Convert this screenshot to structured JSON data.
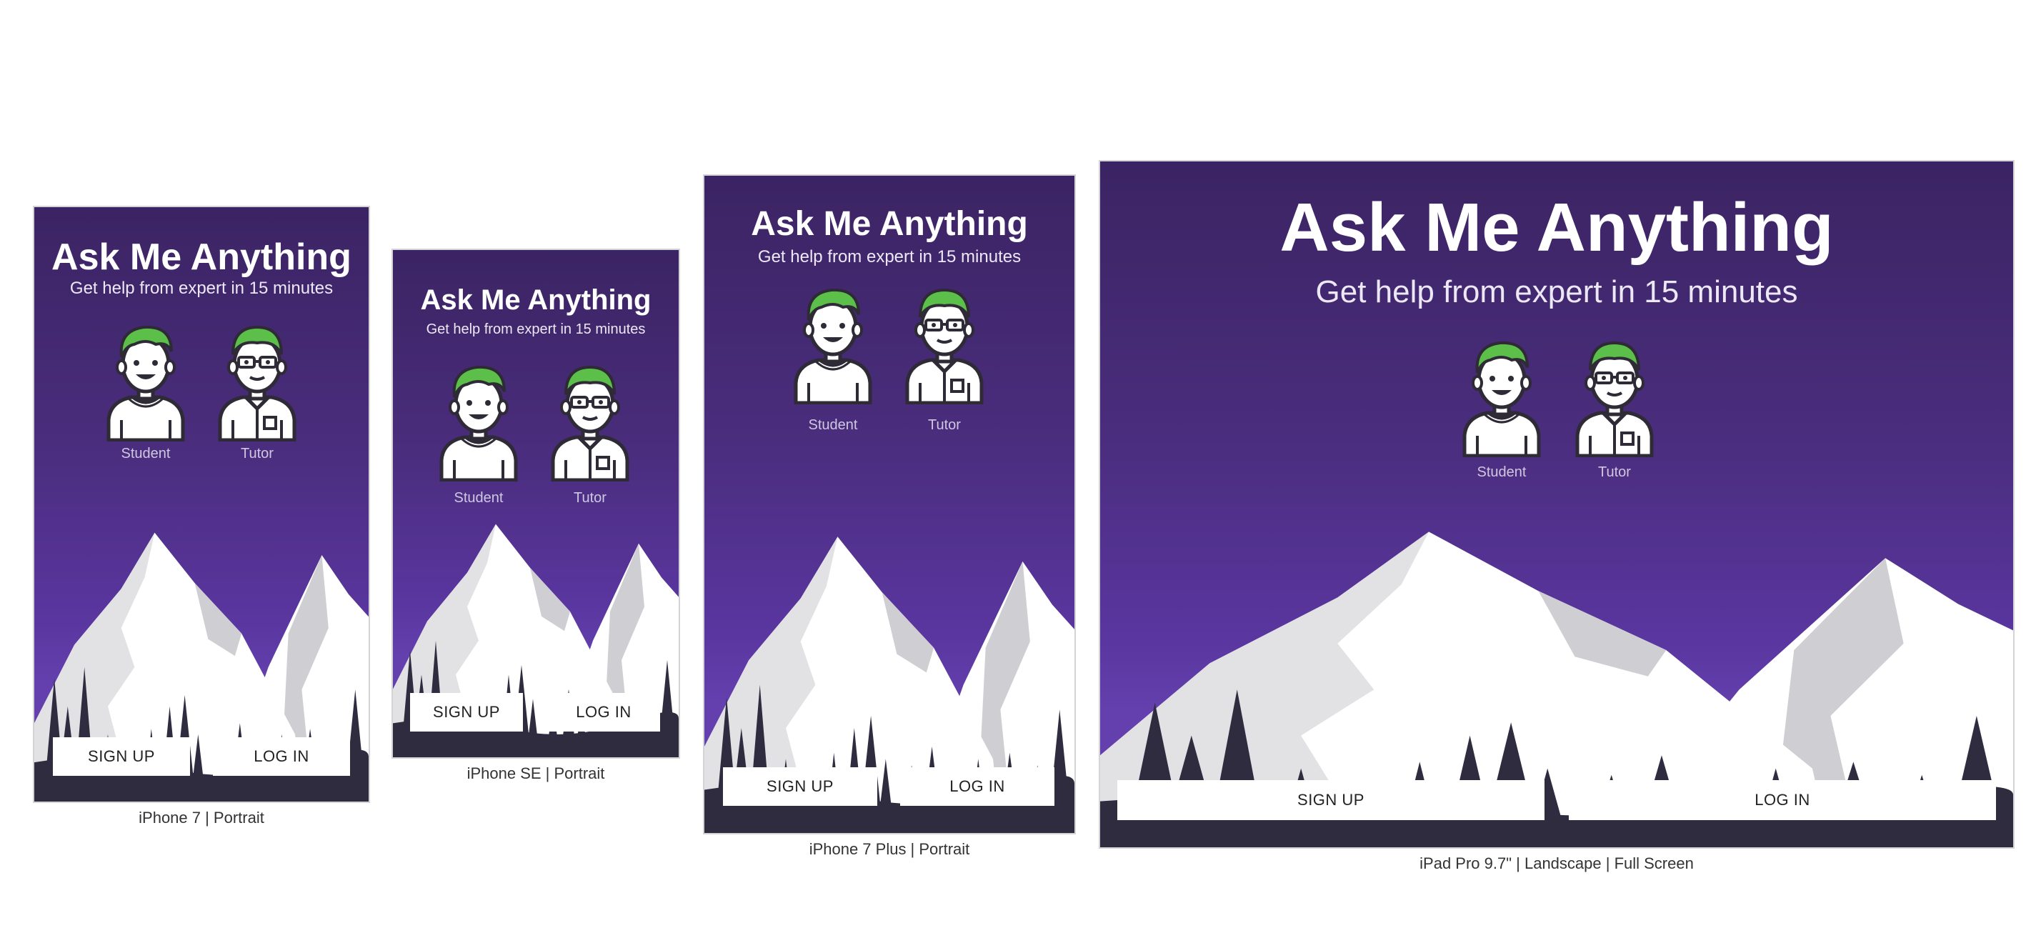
{
  "app": {
    "title": "Ask Me Anything",
    "subtitle": "Get help from expert in 15 minutes",
    "roles": {
      "student": "Student",
      "tutor": "Tutor"
    },
    "buttons": {
      "sign_up": "SIGN UP",
      "log_in": "LOG IN"
    }
  },
  "devices": [
    {
      "caption": "iPhone 7 | Portrait"
    },
    {
      "caption": "iPhone SE | Portrait"
    },
    {
      "caption": "iPhone 7 Plus | Portrait"
    },
    {
      "caption": "iPad Pro 9.7\" | Landscape | Full Screen"
    }
  ],
  "colors": {
    "sky_top": "#3b2463",
    "sky_bottom": "#6340ad",
    "hair": "#5bbf4a",
    "mountain": "#ffffff",
    "mountain_shade": "#cfcfd3",
    "trees": "#2f2c40",
    "button_bg": "#ffffff",
    "button_text": "#222222"
  }
}
